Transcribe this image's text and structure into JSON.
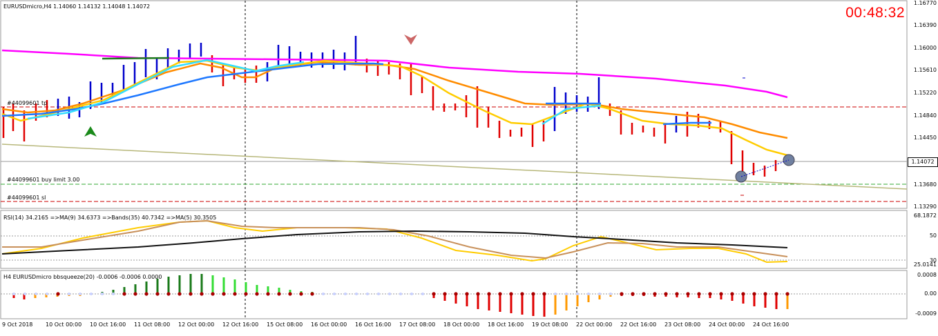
{
  "chart": {
    "symbol_header": "EURUSDmicro,H4  1.14060 1.14132 1.14048 1.14072",
    "timer": "00:48:32",
    "current_price": "1.14072",
    "price_labels": [
      "1.16770",
      "1.16390",
      "1.16000",
      "1.15610",
      "1.15220",
      "1.14840",
      "1.14450",
      "1.13680",
      "1.13290"
    ],
    "order_labels": {
      "tp": "#44099601 tp",
      "buy_limit": "#44099601 buy limit 3.00",
      "sl": "#44099601 sl"
    }
  },
  "rsi": {
    "header": "RSI(14) 34.2165  =>MA(9) 34.6373  =>Bands(35) 40.7342  =>MA(5) 30.3505",
    "labels": [
      "68.1872",
      "50",
      "25.0141",
      "30"
    ]
  },
  "squeeze": {
    "header": "H4 EURUSDmicro bbsqueeze(20) -0.0006 -0.0006 0.0000",
    "labels": [
      "0.0008",
      "0.00",
      "-0.0009"
    ]
  },
  "time_axis": [
    "9 Oct 2018",
    "10 Oct 00:00",
    "10 Oct 16:00",
    "11 Oct 08:00",
    "12 Oct 00:00",
    "12 Oct 16:00",
    "15 Oct 08:00",
    "16 Oct 00:00",
    "16 Oct 16:00",
    "17 Oct 08:00",
    "18 Oct 00:00",
    "18 Oct 16:00",
    "19 Oct 08:00",
    "22 Oct 00:00",
    "22 Oct 16:00",
    "23 Oct 08:00",
    "24 Oct 00:00",
    "24 Oct 16:00"
  ],
  "colors": {
    "bull": "#0000cc",
    "bear": "#e00000",
    "ma_magenta": "#ff00ff",
    "ma_orange": "#ff8c00",
    "ma_yellow": "#ffcc00",
    "ma_blue": "#1e78ff",
    "ma_cyan": "#33ddff",
    "trend": "#b7b77a",
    "timer": "#ff0000"
  }
}
